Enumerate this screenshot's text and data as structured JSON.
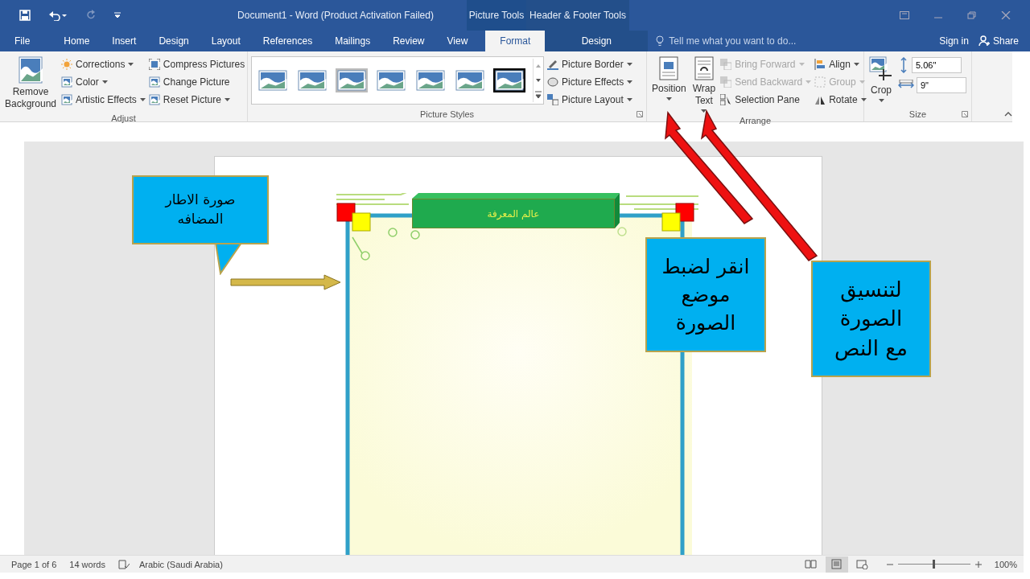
{
  "title_bar": {
    "title": "Document1 - Word (Product Activation Failed)"
  },
  "tabs": [
    {
      "label": "File",
      "selected": false
    },
    {
      "label": "Home",
      "selected": false
    },
    {
      "label": "Insert",
      "selected": false
    },
    {
      "label": "Design",
      "selected": false
    },
    {
      "label": "Layout",
      "selected": false
    },
    {
      "label": "References",
      "selected": false
    },
    {
      "label": "Mailings",
      "selected": false
    },
    {
      "label": "Review",
      "selected": false
    },
    {
      "label": "View",
      "selected": false
    }
  ],
  "context_groups": [
    {
      "label": "Picture Tools",
      "tabs": [
        {
          "label": "Format",
          "selected": true
        }
      ]
    },
    {
      "label": "Header & Footer Tools",
      "tabs": [
        {
          "label": "Design",
          "selected": false
        }
      ]
    }
  ],
  "tell_me": {
    "placeholder": "Tell me what you want to do..."
  },
  "sign_in": "Sign in",
  "share": "Share",
  "ribbon": {
    "groups": [
      {
        "label": "Adjust",
        "large": [
          {
            "label": "Remove Background",
            "dropdown": false
          }
        ],
        "columns": [
          [
            {
              "label": "Corrections",
              "dropdown": true,
              "disabled": false
            },
            {
              "label": "Color",
              "dropdown": true,
              "disabled": false
            },
            {
              "label": "Artistic Effects",
              "dropdown": true,
              "disabled": false
            }
          ],
          [
            {
              "label": "Compress Pictures",
              "dropdown": false,
              "disabled": false
            },
            {
              "label": "Change Picture",
              "dropdown": false,
              "disabled": false
            },
            {
              "label": "Reset Picture",
              "dropdown": true,
              "disabled": false
            }
          ]
        ]
      },
      {
        "label": "Picture Styles",
        "gallery": true,
        "columns": [
          [
            {
              "label": "Picture Border",
              "dropdown": true,
              "disabled": false
            },
            {
              "label": "Picture Effects",
              "dropdown": true,
              "disabled": false
            },
            {
              "label": "Picture Layout",
              "dropdown": true,
              "disabled": false
            }
          ]
        ]
      },
      {
        "label": "Arrange",
        "large": [
          {
            "label": "Position",
            "dropdown": true
          },
          {
            "label": "Wrap Text",
            "dropdown": true
          }
        ],
        "columns": [
          [
            {
              "label": "Bring Forward",
              "dropdown": true,
              "disabled": true
            },
            {
              "label": "Send Backward",
              "dropdown": true,
              "disabled": true
            },
            {
              "label": "Selection Pane",
              "dropdown": false,
              "disabled": false
            }
          ],
          [
            {
              "label": "Align",
              "dropdown": true,
              "disabled": false
            },
            {
              "label": "Group",
              "dropdown": true,
              "disabled": true
            },
            {
              "label": "Rotate",
              "dropdown": true,
              "disabled": false
            }
          ]
        ]
      },
      {
        "label": "Size",
        "large": [
          {
            "label": "Crop",
            "dropdown": true
          }
        ],
        "fields": [
          {
            "value": "5.06\""
          },
          {
            "value": "9\""
          }
        ]
      }
    ]
  },
  "document": {
    "banner_text": "عالم المعرفة",
    "callouts": [
      {
        "text": "صورة الاطار المضافه",
        "kind": "speech"
      },
      {
        "text": "انقر لضبط موضع الصورة",
        "kind": "box"
      },
      {
        "text": "لتنسيق الصورة مع النص",
        "kind": "box"
      }
    ]
  },
  "status_bar": {
    "page": "Page 1 of 6",
    "words": "14 words",
    "language": "Arabic (Saudi Arabia)",
    "views": [
      {
        "kind": "read",
        "selected": false
      },
      {
        "kind": "print",
        "selected": true
      },
      {
        "kind": "web",
        "selected": false
      }
    ],
    "zoom": {
      "level": 0.5,
      "reading": "100%"
    }
  }
}
